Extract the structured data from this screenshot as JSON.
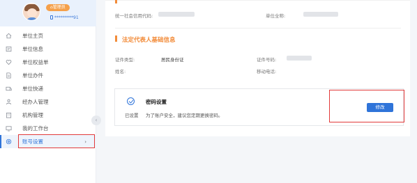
{
  "user": {
    "role_badge": "⌂管理员",
    "phone": "*********91"
  },
  "sidebar": {
    "items": [
      {
        "label": "单位主页",
        "icon": "home-icon"
      },
      {
        "label": "单位信息",
        "icon": "info-card-icon"
      },
      {
        "label": "单位权益单",
        "icon": "heart-icon"
      },
      {
        "label": "单位办件",
        "icon": "document-icon"
      },
      {
        "label": "单位快递",
        "icon": "package-icon"
      },
      {
        "label": "经办人管理",
        "icon": "people-icon"
      },
      {
        "label": "机构管理",
        "icon": "building-icon"
      },
      {
        "label": "我的工作台",
        "icon": "workbench-icon"
      },
      {
        "label": "账号设置",
        "icon": "settings-icon",
        "active": true
      }
    ],
    "collapse_glyph": "‹",
    "chevron_glyph": "›"
  },
  "unit_info": {
    "credit_code_label": "统一社会信用代码:",
    "name_label": "单位全称:"
  },
  "legal_rep": {
    "section_title": "法定代表人基础信息",
    "id_type_label": "证件类型:",
    "id_type_value": "居民身份证",
    "id_number_label": "证件号码:",
    "name_label": "姓名:",
    "mobile_label": "移动电话:"
  },
  "password": {
    "title": "密码设置",
    "status": "已设置",
    "description": "为了账户安全，建议您定期更换密码。",
    "edit_label": "修改"
  },
  "colors": {
    "accent": "#f28c3a",
    "primary": "#2f74d9",
    "highlight": "#e23a3a"
  }
}
